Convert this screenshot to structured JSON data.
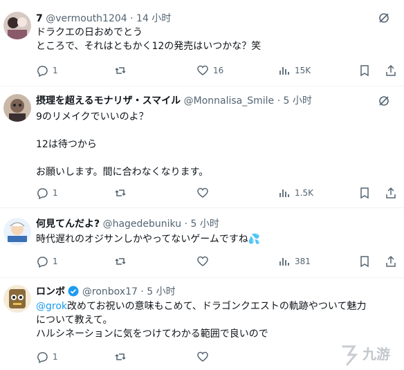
{
  "posts": [
    {
      "name": "7",
      "handle": "@vermouth1204",
      "dot": "·",
      "time": "14 小时",
      "lines": [
        "ドラクエの日おめでとう",
        "ところで、それはともかく12の発売はいつかな？笑"
      ],
      "replies": "1",
      "retweets": "",
      "likes": "16",
      "views": "15K"
    },
    {
      "name": "摂理を超えるモナリザ・スマイル",
      "handle": "@Monnalisa_Smile",
      "dot": "·",
      "time": "5 小时",
      "lines": [
        "9のリメイクでいいのよ？",
        "",
        "12は待つから",
        "",
        "お願いします。間に合わなくなります。"
      ],
      "replies": "1",
      "retweets": "",
      "likes": "",
      "views": "1.5K"
    },
    {
      "name": "何見てんだよ?",
      "handle": "@hagedebuniku",
      "dot": "·",
      "time": "5 小时",
      "lines": [
        "時代遅れのオジサンしかやってないゲームですね"
      ],
      "emoji": "💦",
      "replies": "1",
      "retweets": "",
      "likes": "",
      "views": "381"
    },
    {
      "name": "ロンボ",
      "handle": "@ronbox17",
      "dot": "·",
      "time": "5 小时",
      "mention": "@grok",
      "line1_rest": "改めてお祝いの意味もこめて、ドラゴンクエストの軌跡やついて魅力",
      "line2": "について教えて。",
      "line3": "ハルシネーションに気をつけてわかる範囲で良いので",
      "replies": "1",
      "retweets": "",
      "likes": ""
    }
  ],
  "watermark": {
    "text": "九游"
  },
  "colors": {
    "muted": "#536471",
    "link": "#1d9bf0",
    "separator": "#eff3f4"
  },
  "icons": [
    "reply-icon",
    "retweet-icon",
    "like-icon",
    "views-icon",
    "bookmark-icon",
    "share-icon",
    "grok-icon",
    "verified-icon"
  ]
}
